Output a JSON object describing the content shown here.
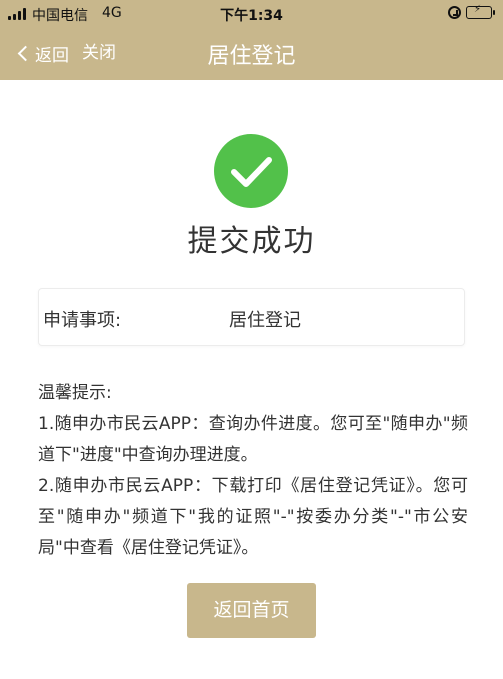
{
  "status_bar": {
    "carrier": "中国电信",
    "network": "4G",
    "time": "下午1:34"
  },
  "navbar": {
    "back_label": "返回",
    "close_label": "关闭",
    "title": "居住登记"
  },
  "result": {
    "icon": "checkmark-circle-icon",
    "title": "提交成功"
  },
  "application": {
    "label": "申请事项:",
    "value": "居住登记"
  },
  "tips": {
    "heading": "温馨提示:",
    "items": [
      "1.随申办市民云APP：查询办件进度。您可至\"随申办\"频道下\"进度\"中查询办理进度。",
      "2.随申办市民云APP：下载打印《居住登记凭证》。您可至\"随申办\"频道下\"我的证照\"-\"按委办分类\"-\"市公安局\"中查看《居住登记凭证》。"
    ]
  },
  "actions": {
    "home_label": "返回首页"
  },
  "colors": {
    "brand": "#c8b78c",
    "success": "#52c14a"
  }
}
